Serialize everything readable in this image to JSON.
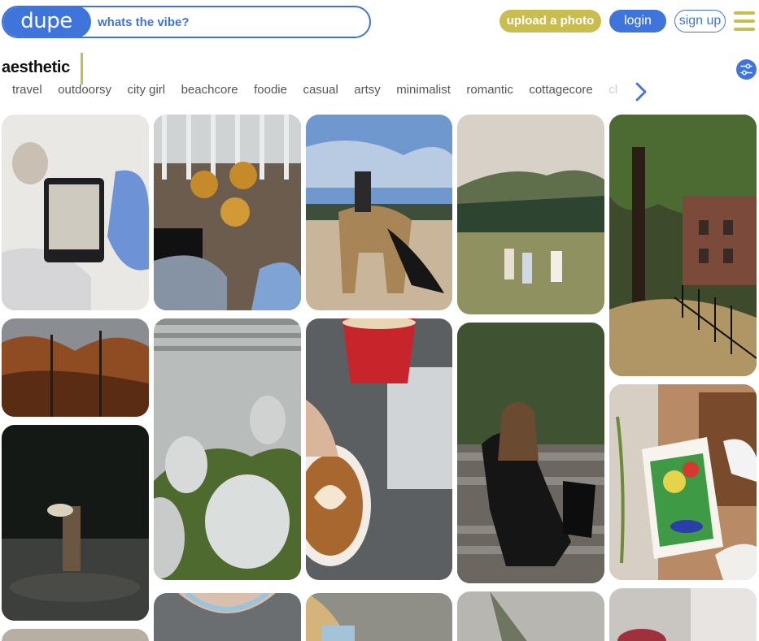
{
  "header": {
    "logo": "dupe",
    "search_placeholder": "whats the vibe?",
    "upload_label": "upload a photo",
    "login_label": "login",
    "signup_label": "sign up"
  },
  "categories": {
    "active": "aesthetic",
    "items": [
      "travel",
      "outdoorsy",
      "city girl",
      "beachcore",
      "foodie",
      "casual",
      "artsy",
      "minimalist",
      "romantic",
      "cottagecore",
      "cl"
    ]
  },
  "icons": {
    "menu": "hamburger-icon",
    "filter": "sliders-icon",
    "next": "chevron-right-icon"
  },
  "colors": {
    "brand_blue": "#3f74db",
    "brand_olive": "#c9bd4f"
  }
}
